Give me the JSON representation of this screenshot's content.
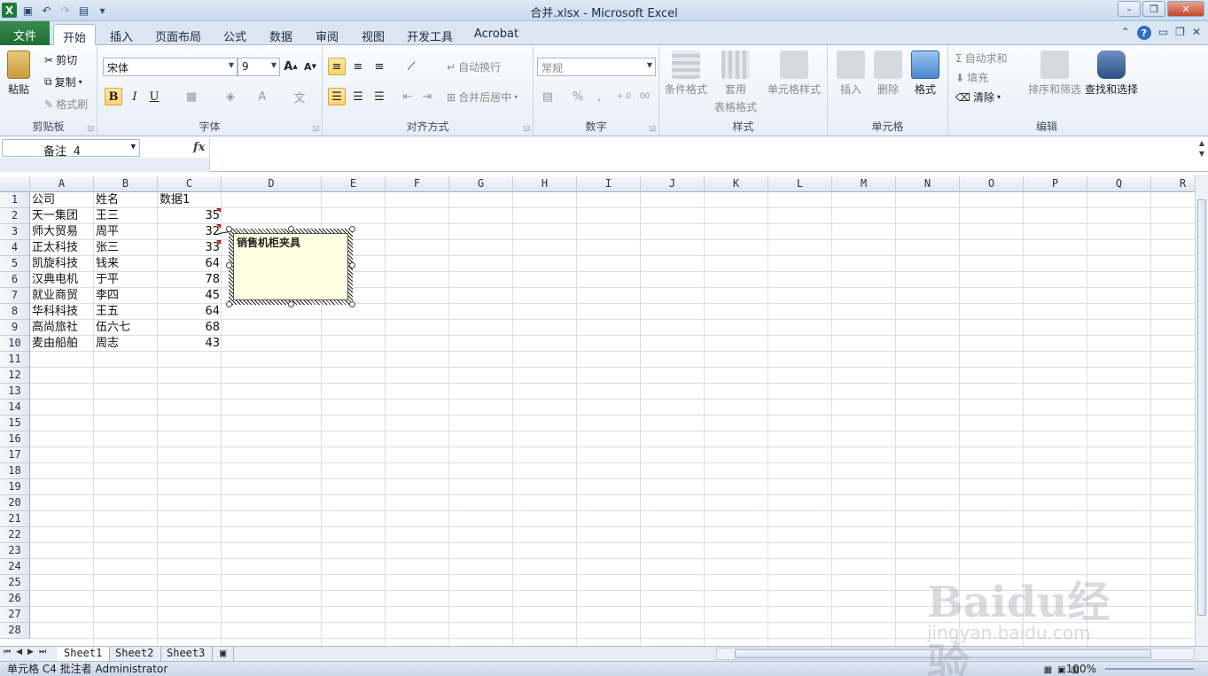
{
  "window": {
    "title": "合并.xlsx  -  Microsoft Excel"
  },
  "tabs": {
    "file": "文件",
    "items": [
      "开始",
      "插入",
      "页面布局",
      "公式",
      "数据",
      "审阅",
      "视图",
      "开发工具",
      "Acrobat"
    ],
    "active": "开始"
  },
  "ribbon": {
    "clipboard": {
      "label": "剪贴板",
      "paste": "粘贴",
      "cut": "剪切",
      "copy": "复制",
      "format_painter": "格式刷"
    },
    "font": {
      "label": "字体",
      "font_name": "宋体",
      "font_size": "9",
      "bold": "B",
      "italic": "I",
      "underline": "U"
    },
    "alignment": {
      "label": "对齐方式",
      "wrap": "自动换行",
      "merge": "合并后居中"
    },
    "number": {
      "label": "数字",
      "format": "常规",
      "percent": "%",
      "comma": ","
    },
    "styles": {
      "label": "样式",
      "conditional": "条件格式",
      "table_format_1": "套用",
      "table_format_2": "表格格式",
      "cell_styles": "单元格样式"
    },
    "cells": {
      "label": "单元格",
      "insert": "插入",
      "delete": "删除",
      "format": "格式"
    },
    "editing": {
      "label": "编辑",
      "autosum": "自动求和",
      "fill": "填充",
      "clear": "清除",
      "sort": "排序和筛选",
      "find": "查找和选择"
    }
  },
  "formula_bar": {
    "name_box": "备注 4",
    "fx": "fx",
    "content": ""
  },
  "columns": [
    "A",
    "B",
    "C",
    "D",
    "E",
    "F",
    "G",
    "H",
    "I",
    "J",
    "K",
    "L",
    "M",
    "N",
    "O",
    "P",
    "Q",
    "R"
  ],
  "rows": [
    "1",
    "2",
    "3",
    "4",
    "5",
    "6",
    "7",
    "8",
    "9",
    "10",
    "11",
    "12",
    "13",
    "14",
    "15",
    "16",
    "17",
    "18",
    "19",
    "20",
    "21",
    "22",
    "23",
    "24",
    "25",
    "26",
    "27",
    "28"
  ],
  "table": {
    "headers": [
      "公司",
      "姓名",
      "数据1"
    ],
    "rows": [
      [
        "天一集团",
        "王三",
        "35"
      ],
      [
        "师大贸易",
        "周平",
        "32"
      ],
      [
        "正太科技",
        "张三",
        "33"
      ],
      [
        "凯旋科技",
        "钱来",
        "64"
      ],
      [
        "汉典电机",
        "于平",
        "78"
      ],
      [
        "就业商贸",
        "李四",
        "45"
      ],
      [
        "华科科技",
        "王五",
        "64"
      ],
      [
        "高尚旅社",
        "伍六七",
        "68"
      ],
      [
        "麦由船舶",
        "周志",
        "43"
      ]
    ]
  },
  "comment": {
    "text": "销售机柜夹具"
  },
  "sheets": {
    "items": [
      "Sheet1",
      "Sheet2",
      "Sheet3"
    ],
    "active": "Sheet1"
  },
  "status": {
    "text": "单元格 C4 批注者 Administrator",
    "zoom": "100%"
  },
  "watermark": {
    "big": "Baidu经验",
    "small": "jingyan.baidu.com"
  }
}
